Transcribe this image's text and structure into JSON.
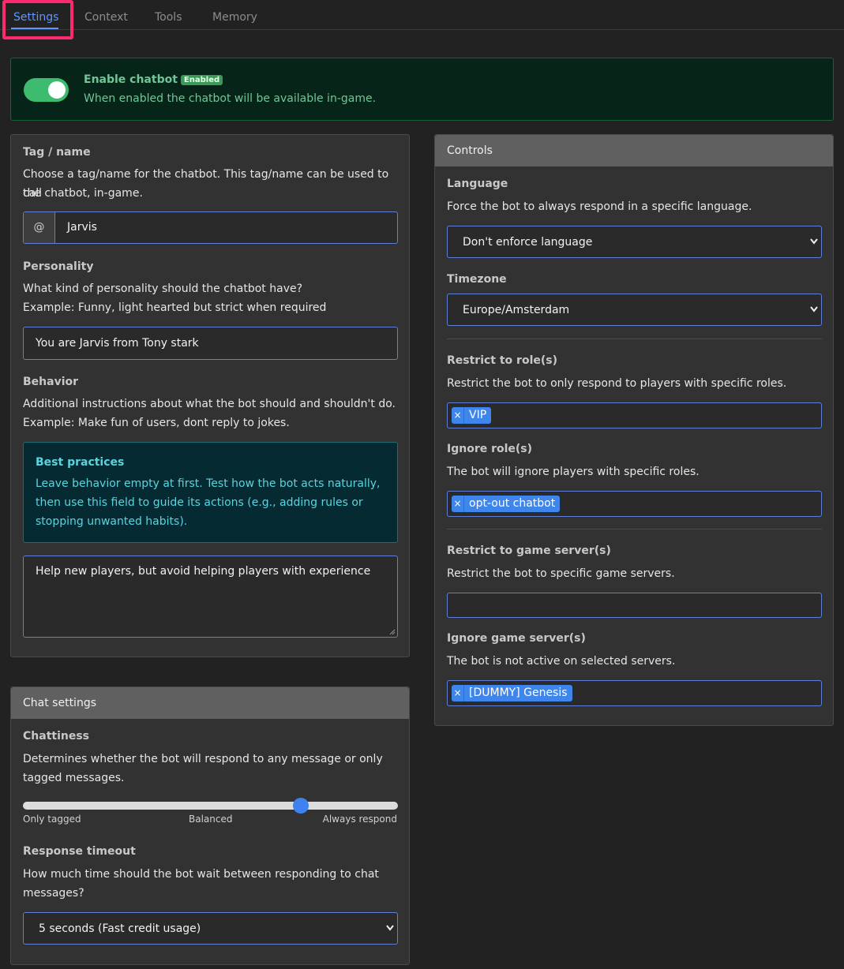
{
  "tabs": [
    "Settings",
    "Context",
    "Tools",
    "Memory"
  ],
  "banner": {
    "title": "Enable chatbot",
    "badge": "Enabled",
    "description": "When enabled the chatbot will be available in-game.",
    "enabled": true
  },
  "tag_name": {
    "label": "Tag / name",
    "desc1": "Choose a tag/name for the chatbot. This tag/name can be used to call",
    "desc2": "the chatbot, in-game.",
    "prefix": "@",
    "value": "Jarvis"
  },
  "personality": {
    "label": "Personality",
    "desc1": "What kind of personality should the chatbot have?",
    "desc2": "Example: Funny, light hearted but strict when required",
    "value": "You are Jarvis from Tony stark"
  },
  "behavior": {
    "label": "Behavior",
    "desc1": "Additional instructions about what the bot should and shouldn't do.",
    "desc2": "Example: Make fun of users, dont reply to jokes.",
    "info_title": "Best practices",
    "info_line1": "Leave behavior empty at first. Test how the bot acts naturally,",
    "info_line2": "then use this field to guide its actions (e.g., adding rules or",
    "info_line3": "stopping unwanted habits).",
    "value": "Help new players, but avoid helping players with experience"
  },
  "chat_settings": {
    "header": "Chat settings",
    "chattiness_label": "Chattiness",
    "chattiness_desc1": "Determines whether the bot will respond to any message or only",
    "chattiness_desc2": "tagged messages.",
    "slider_value": 0.74,
    "slider_min_label": "Only tagged",
    "slider_mid_label": "Balanced",
    "slider_max_label": "Always respond",
    "timeout_label": "Response timeout",
    "timeout_desc1": "How much time should the bot wait between responding to chat",
    "timeout_desc2": "messages?",
    "timeout_value": "5 seconds (Fast credit usage)"
  },
  "controls": {
    "header": "Controls",
    "language_label": "Language",
    "language_desc": "Force the bot to always respond in a specific language.",
    "language_value": "Don't enforce language",
    "timezone_label": "Timezone",
    "timezone_value": "Europe/Amsterdam",
    "restrict_roles_label": "Restrict to role(s)",
    "restrict_roles_desc": "Restrict the bot to only respond to players with specific roles.",
    "restrict_roles_tags": [
      "VIP"
    ],
    "ignore_roles_label": "Ignore role(s)",
    "ignore_roles_desc": "The bot will ignore players with specific roles.",
    "ignore_roles_tags": [
      "opt-out chatbot"
    ],
    "restrict_servers_label": "Restrict to game server(s)",
    "restrict_servers_desc": "Restrict the bot to specific game servers.",
    "ignore_servers_label": "Ignore game server(s)",
    "ignore_servers_desc": "The bot is not active on selected servers.",
    "ignore_servers_tags": [
      "[DUMMY] Genesis"
    ],
    "tag_remove_glyph": "×"
  }
}
